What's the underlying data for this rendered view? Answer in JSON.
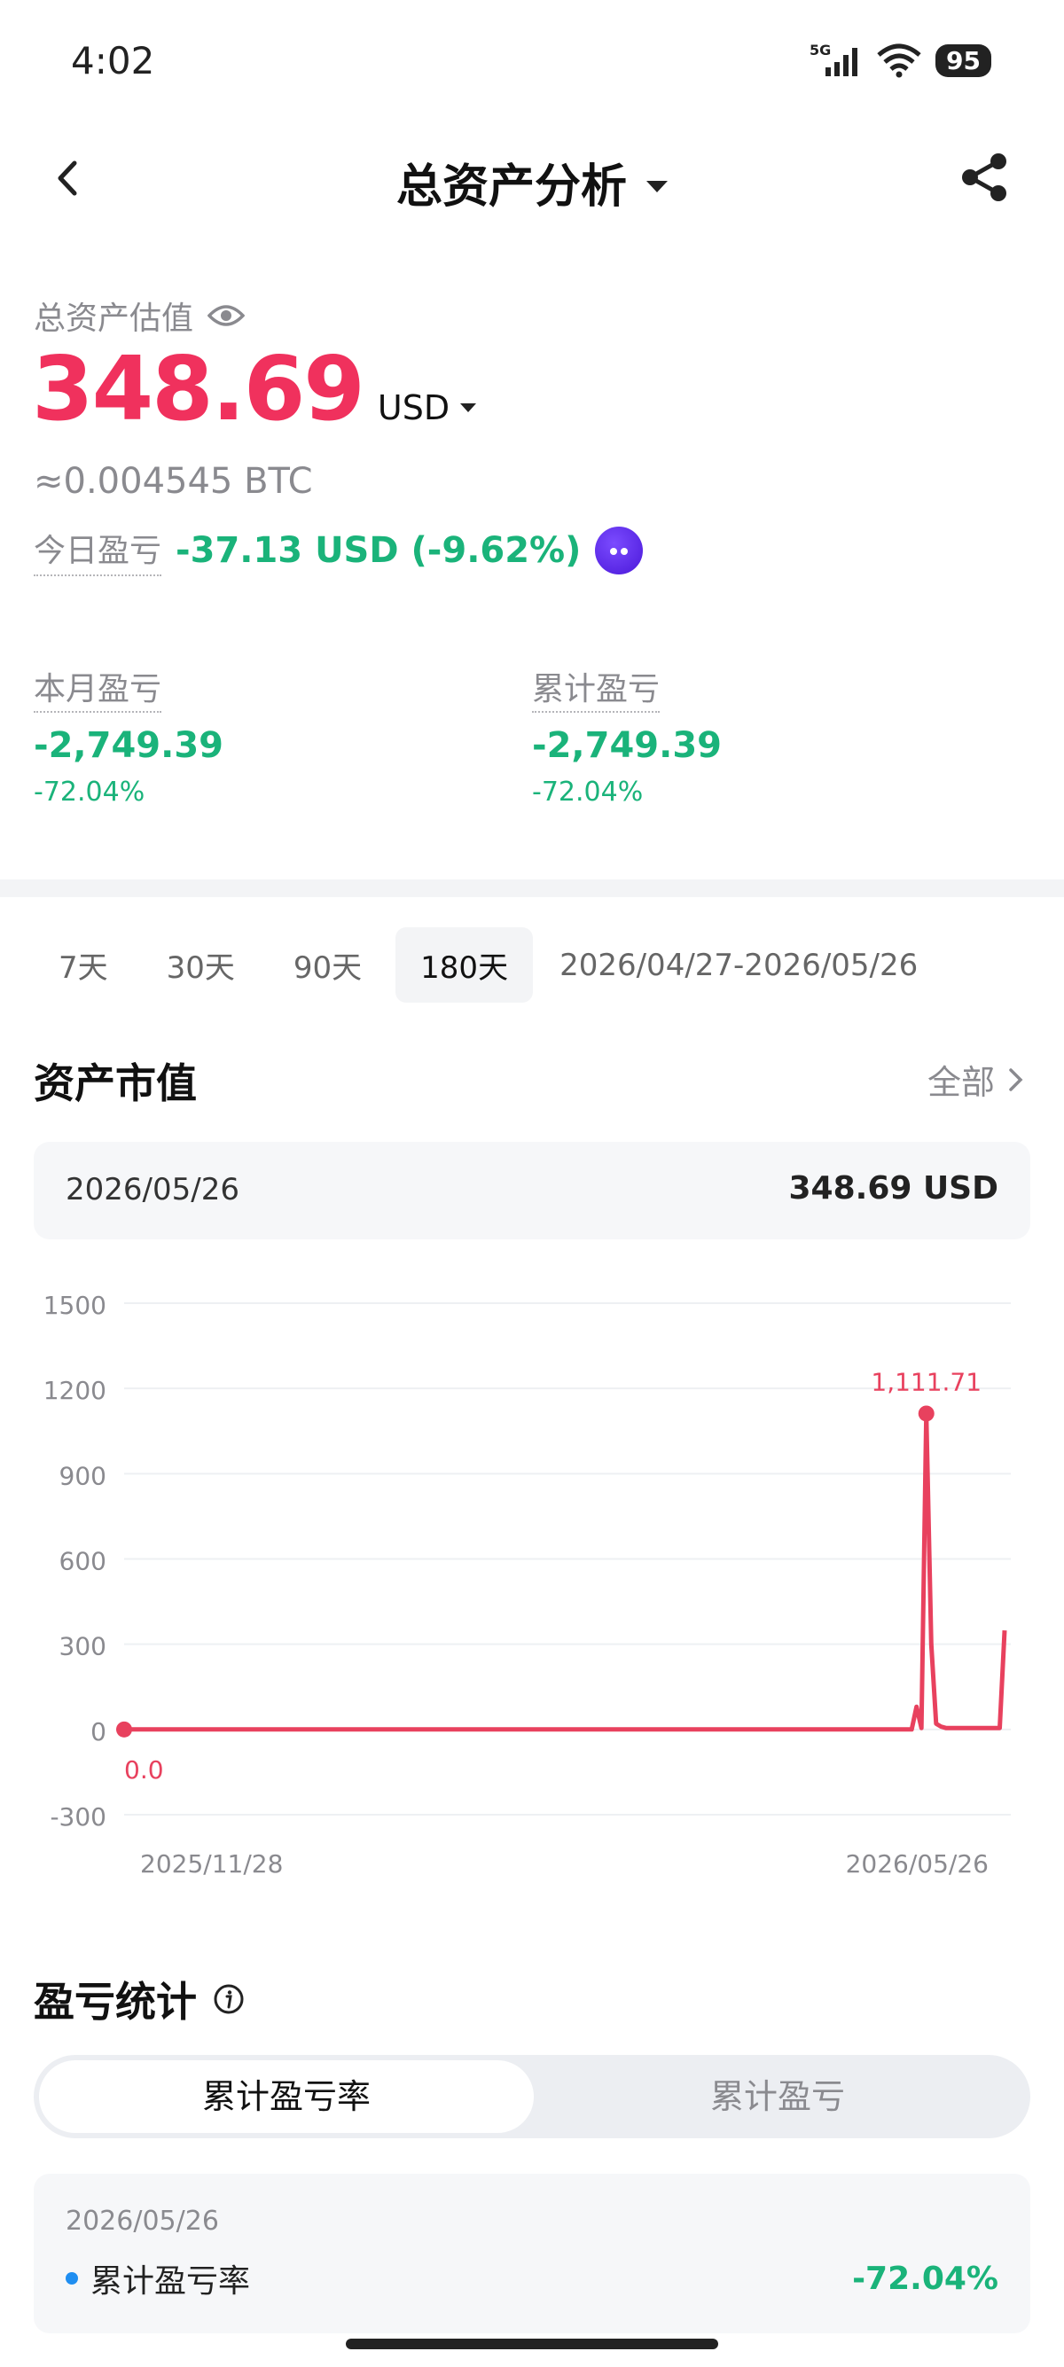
{
  "status_bar": {
    "time": "4:02",
    "network": "5G",
    "battery": "95"
  },
  "nav": {
    "title": "总资产分析"
  },
  "summary": {
    "total_label": "总资产估值",
    "total_value": "348.69",
    "currency": "USD",
    "btc_equiv": "≈0.004545 BTC",
    "today_label": "今日盈亏",
    "today_pnl": "-37.13 USD (-9.62%)",
    "month": {
      "label": "本月盈亏",
      "value": "-2,749.39",
      "pct": "-72.04%"
    },
    "cumulative": {
      "label": "累计盈亏",
      "value": "-2,749.39",
      "pct": "-72.04%"
    }
  },
  "range_tabs": {
    "items": [
      "7天",
      "30天",
      "90天",
      "180天"
    ],
    "active": "180天",
    "date_range": "2026/04/27-2026/05/26"
  },
  "asset_section": {
    "title": "资产市值",
    "all_link": "全部",
    "selected_date": "2026/05/26",
    "selected_value": "348.69 USD"
  },
  "chart_data": {
    "type": "line",
    "y_ticks": [
      "1500",
      "1200",
      "900",
      "600",
      "300",
      "0",
      "-300"
    ],
    "ylim": [
      -300,
      1500
    ],
    "x_labels": [
      "2025/11/28",
      "2026/05/26"
    ],
    "series": [
      {
        "values": [
          0,
          0,
          0,
          0,
          0,
          0,
          0,
          0,
          0,
          0,
          0,
          0,
          0,
          0,
          0,
          0,
          0,
          0,
          0,
          0,
          0,
          0,
          0,
          0,
          0,
          0,
          0,
          0,
          0,
          0,
          0,
          0,
          0,
          0,
          0,
          0,
          0,
          0,
          0,
          0,
          0,
          0,
          0,
          0,
          0,
          0,
          0,
          0,
          0,
          0,
          0,
          0,
          0,
          0,
          0,
          0,
          0,
          0,
          0,
          0,
          0,
          0,
          0,
          0,
          0,
          0,
          0,
          0,
          0,
          0,
          0,
          0,
          0,
          0,
          0,
          0,
          0,
          0,
          0,
          0,
          0,
          0,
          0,
          0,
          0,
          0,
          0,
          0,
          0,
          0,
          0,
          0,
          0,
          0,
          0,
          0,
          0,
          0,
          0,
          0,
          0,
          0,
          0,
          0,
          0,
          0,
          0,
          0,
          0,
          0,
          0,
          0,
          0,
          0,
          0,
          0,
          0,
          0,
          0,
          0,
          0,
          0,
          0,
          0,
          0,
          0,
          0,
          0,
          0,
          0,
          0,
          0,
          0,
          0,
          0,
          0,
          0,
          0,
          0,
          0,
          0,
          0,
          0,
          0,
          0,
          0,
          0,
          0,
          0,
          0,
          0,
          0,
          0,
          0,
          0,
          0,
          0,
          0,
          0,
          0,
          0,
          0,
          80,
          5,
          1111.71,
          300,
          20,
          10,
          5,
          5,
          5,
          5,
          5,
          5,
          5,
          5,
          5,
          5,
          5,
          5,
          348.69
        ],
        "color": "#e8415e"
      }
    ],
    "annotations": [
      {
        "label": "1,111.71",
        "kind": "max"
      },
      {
        "label": "0.0",
        "kind": "min"
      }
    ],
    "grid": true
  },
  "pnl_section": {
    "title": "盈亏统计",
    "toggle": [
      "累计盈亏率",
      "累计盈亏"
    ],
    "card": {
      "date": "2026/05/26",
      "row_label": "累计盈亏率",
      "row_value": "-72.04%"
    }
  }
}
